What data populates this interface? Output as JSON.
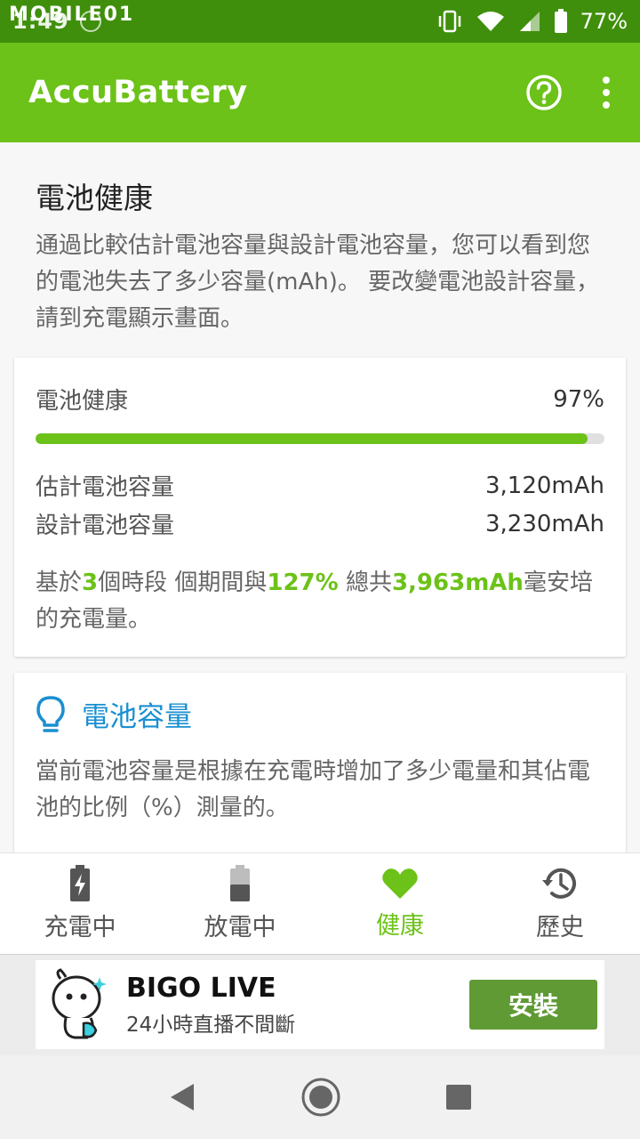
{
  "status_bar": {
    "time": "1:49",
    "watermark": "MOBILE01",
    "battery_percent": "77%"
  },
  "app_bar": {
    "title": "AccuBattery",
    "help_icon": "help-circle-icon",
    "menu_icon": "more-vertical-icon"
  },
  "intro": {
    "title": "電池健康",
    "text": "通過比較估計電池容量與設計電池容量，您可以看到您的電池失去了多少容量(mAh)。 要改變電池設計容量，請到充電顯示畫面。"
  },
  "health_card": {
    "label": "電池健康",
    "value": "97%",
    "progress": 0.97,
    "estimated_label": "估計電池容量",
    "estimated_value": "3,120mAh",
    "design_label": "設計電池容量",
    "design_value": "3,230mAh",
    "summary": {
      "p1": "基於",
      "sessions": "3",
      "p2": "個時段 個期間與",
      "percent": "127%",
      "p3": " 總共",
      "total": "3,963mAh",
      "p4": "毫安培的充電量。"
    }
  },
  "capacity_card": {
    "title": "電池容量",
    "text": "當前電池容量是根據在充電時增加了多少電量和其佔電池的比例（%）測量的。"
  },
  "bottom_nav": {
    "items": [
      {
        "label": "充電中"
      },
      {
        "label": "放電中"
      },
      {
        "label": "健康"
      },
      {
        "label": "歷史"
      }
    ]
  },
  "ad": {
    "title": "BIGO LIVE",
    "subtitle": "24小時直播不間斷",
    "button": "安裝"
  },
  "colors": {
    "status_bar": "#3f8f0c",
    "app_bar": "#6cc218",
    "accent": "#6cc218",
    "link_blue": "#1a8fd0",
    "ad_button": "#5f9a34"
  }
}
